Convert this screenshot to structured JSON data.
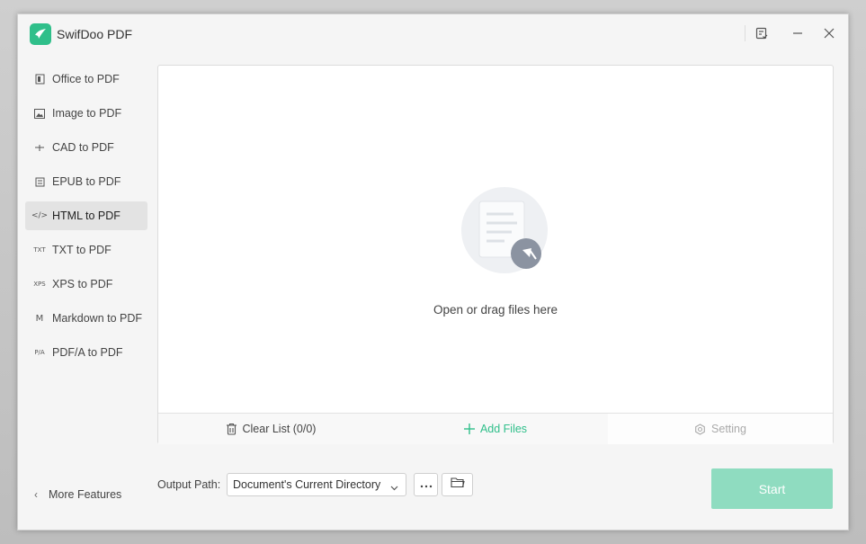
{
  "app": {
    "title": "SwifDoo PDF"
  },
  "sidebar": {
    "items": [
      {
        "label": "Office to PDF",
        "icon": "office-icon",
        "glyph": ""
      },
      {
        "label": "Image to PDF",
        "icon": "image-icon",
        "glyph": ""
      },
      {
        "label": "CAD to PDF",
        "icon": "cad-icon",
        "glyph": ""
      },
      {
        "label": "EPUB to PDF",
        "icon": "epub-icon",
        "glyph": ""
      },
      {
        "label": "HTML to PDF",
        "icon": "html-icon",
        "glyph": "</>"
      },
      {
        "label": "TXT to PDF",
        "icon": "txt-icon",
        "glyph": "TXT"
      },
      {
        "label": "XPS to PDF",
        "icon": "xps-icon",
        "glyph": "XPS"
      },
      {
        "label": "Markdown to PDF",
        "icon": "markdown-icon",
        "glyph": "M"
      },
      {
        "label": "PDF/A to PDF",
        "icon": "pdfa-icon",
        "glyph": "P/A"
      }
    ],
    "more_features": "More Features"
  },
  "main": {
    "drop_text": "Open or drag files here",
    "clear_list": "Clear List (0/0)",
    "add_files": "Add Files",
    "setting": "Setting"
  },
  "output": {
    "label": "Output Path:",
    "selected": "Document's Current Directory"
  },
  "start_label": "Start",
  "colors": {
    "accent": "#2fbf8a",
    "start_disabled": "#8fdcc0"
  }
}
